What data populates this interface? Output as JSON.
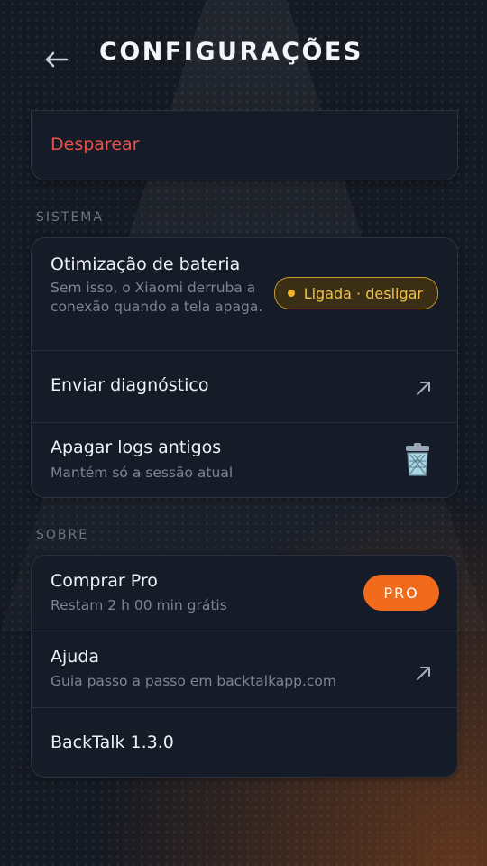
{
  "header": {
    "title": "CONFIGURAÇÕES",
    "back_icon": "arrow-left-icon"
  },
  "account": {
    "disappear_label": "Desparear"
  },
  "sections": {
    "system": "SISTEMA",
    "about": "SOBRE"
  },
  "system": {
    "battery": {
      "title": "Otimização de bateria",
      "subtitle": "Sem isso, o Xiaomi derruba a conexão quando a tela apaga.",
      "status": "Ligada · desligar",
      "status_color": "#f0c24a"
    },
    "diagnostics": {
      "title": "Enviar diagnóstico",
      "icon": "external-arrow-icon"
    },
    "clear_logs": {
      "title": "Apagar logs antigos",
      "subtitle": "Mantém só a sessão atual",
      "icon": "trash-icon"
    }
  },
  "about": {
    "buy_pro": {
      "title": "Comprar Pro",
      "subtitle": "Restam 2 h 00 min grátis",
      "button": "PRO",
      "accent": "#f26b1d"
    },
    "help": {
      "title": "Ajuda",
      "subtitle": "Guia passo a passo em backtalkapp.com",
      "icon": "external-arrow-icon"
    },
    "version": {
      "title": "BackTalk 1.3.0"
    }
  },
  "colors": {
    "background": "#141922",
    "card": "#161c27",
    "danger": "#e5534b"
  }
}
